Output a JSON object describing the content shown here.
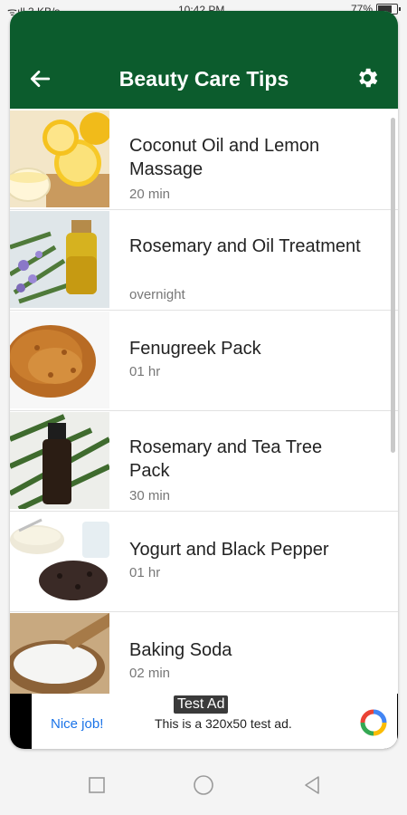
{
  "status_bar": {
    "network": "ᯤıll 3 KB/s",
    "time": "10:42 PM",
    "battery": "77%"
  },
  "app_bar": {
    "title": "Beauty Care Tips",
    "back_icon": "arrow-left-icon",
    "settings_icon": "gear-icon"
  },
  "tips": [
    {
      "name": "Coconut Oil and Lemon Massage",
      "duration": "20 min",
      "image": "lemon-oil-bowl"
    },
    {
      "name": "Rosemary and Oil Treatment",
      "duration": "overnight",
      "image": "rosemary-oil-bottle"
    },
    {
      "name": "Fenugreek Pack",
      "duration": "01 hr",
      "image": "fenugreek-seeds"
    },
    {
      "name": "Rosemary and Tea Tree Pack",
      "duration": "30 min",
      "image": "tea-tree-bottle"
    },
    {
      "name": "Yogurt and Black Pepper",
      "duration": "01 hr",
      "image": "yogurt-pepper"
    },
    {
      "name": "Baking Soda",
      "duration": "02 min",
      "image": "baking-soda"
    }
  ],
  "ad": {
    "badge": "Test Ad",
    "left_text": "Nice job!",
    "main_text": "This is a 320x50 test ad."
  },
  "nav": [
    "recents-icon",
    "home-icon",
    "back-triangle-icon"
  ],
  "colors": {
    "app_bar": "#0c5c2d",
    "ad_link": "#1a73e8"
  }
}
